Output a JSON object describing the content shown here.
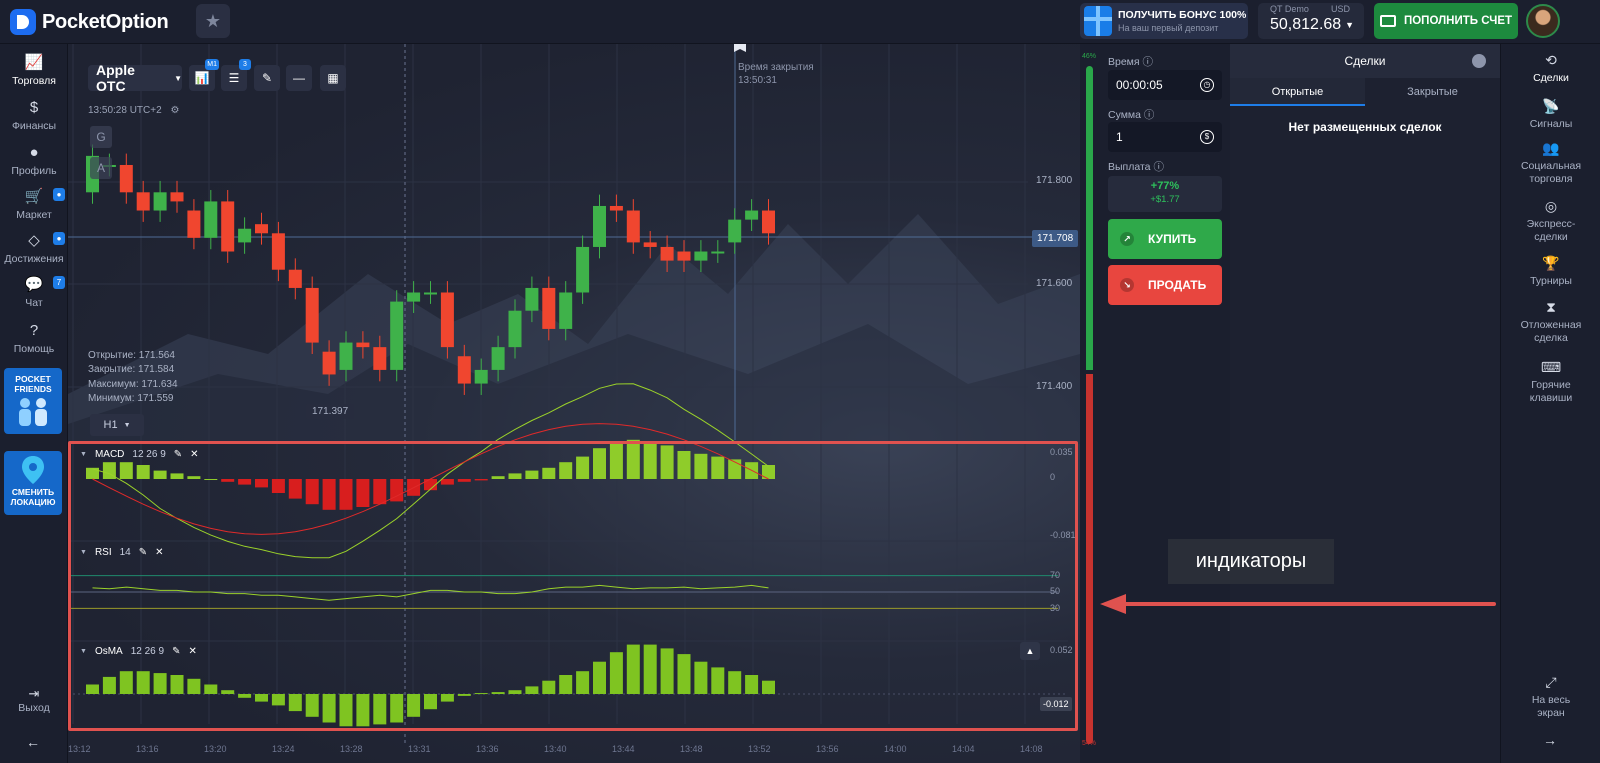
{
  "app": {
    "logo_text": "PocketOption",
    "bonus_title": "ПОЛУЧИТЬ БОНУС 100%",
    "bonus_sub": "На ваш первый депозит",
    "account_label": "QT Demo",
    "account_currency": "USD",
    "balance": "50,812.68",
    "deposit_label": "ПОПОЛНИТЬ СЧЕТ"
  },
  "left_nav": {
    "items": [
      {
        "label": "Торговля",
        "icon": "chart-line-icon",
        "badge": ""
      },
      {
        "label": "Финансы",
        "icon": "dollar-icon",
        "badge": ""
      },
      {
        "label": "Профиль",
        "icon": "user-icon",
        "badge": ""
      },
      {
        "label": "Маркет",
        "icon": "cart-icon",
        "badge": "●"
      },
      {
        "label": "Достижения",
        "icon": "diamond-icon",
        "badge": "●"
      },
      {
        "label": "Чат",
        "icon": "chat-icon",
        "badge": "7"
      },
      {
        "label": "Помощь",
        "icon": "help-icon",
        "badge": ""
      }
    ],
    "promo_friends": "POCKET FRIENDS",
    "promo_location": "СМЕНИТЬ ЛОКАЦИЮ",
    "exit_label": "Выход"
  },
  "chart": {
    "asset": "Apple OTC",
    "indicator_badge_m1": "M1",
    "indicator_badge_count": "3",
    "server_time": "13:50:28 UTC+2",
    "drawing_buttons": [
      "G",
      "A"
    ],
    "ohlc": {
      "open": "Открытие: 171.564",
      "close": "Закрытие: 171.584",
      "high": "Максимум: 171.634",
      "low": "Минимум: 171.559"
    },
    "timeframe": "H1",
    "close_time_label": "Время закрытия",
    "close_time_value": "13:50:31",
    "price_ticks": [
      "171.800",
      "171.600",
      "171.400"
    ],
    "current_price": "171.708",
    "low_marker": "171.397",
    "x_ticks": [
      "13:12",
      "13:16",
      "13:20",
      "13:24",
      "13:28",
      "13:31",
      "13:36",
      "13:40",
      "13:44",
      "13:48",
      "13:52",
      "13:56",
      "14:00",
      "14:04",
      "14:08"
    ],
    "colors": {
      "up": "#3fb24a",
      "down": "#f0462f",
      "macd_line": "#9bd22a",
      "signal_line": "#e02a2a",
      "rsi_line": "#9bd22a"
    }
  },
  "indicators": {
    "macd": {
      "name": "MACD",
      "params": "12 26 9",
      "scale": [
        "0.035",
        "0",
        "-0.081"
      ]
    },
    "rsi": {
      "name": "RSI",
      "params": "14",
      "scale": [
        "70",
        "50",
        "30"
      ]
    },
    "osma": {
      "name": "OsMA",
      "params": "12 26 9",
      "scale": [
        "0.052"
      ],
      "value": "-0.012"
    }
  },
  "volume": {
    "up_pct": "46%",
    "down_pct": "54%"
  },
  "trade": {
    "time_label": "Время",
    "time_value": "00:00:05",
    "amount_label": "Сумма",
    "amount_value": "1",
    "payout_label": "Выплата",
    "payout_pct": "+77%",
    "payout_amount": "+$1.77",
    "buy_label": "КУПИТЬ",
    "sell_label": "ПРОДАТЬ"
  },
  "deals": {
    "title": "Сделки",
    "tab_open": "Открытые",
    "tab_closed": "Закрытые",
    "empty": "Нет размещенных сделок"
  },
  "annotation": {
    "label": "индикаторы"
  },
  "right_nav": {
    "items": [
      {
        "label": "Сделки",
        "icon": "deals-icon"
      },
      {
        "label": "Сигналы",
        "icon": "signal-icon"
      },
      {
        "label": "Социальная торговля",
        "icon": "users-icon"
      },
      {
        "label": "Экспресс-сделки",
        "icon": "target-icon"
      },
      {
        "label": "Турниры",
        "icon": "trophy-icon"
      },
      {
        "label": "Отложенная сделка",
        "icon": "hourglass-icon"
      },
      {
        "label": "Горячие клавиши",
        "icon": "keyboard-icon"
      }
    ],
    "fullscreen": "На весь экран"
  },
  "chart_data": {
    "type": "candlestick",
    "candles": [
      {
        "o": 171.8,
        "c": 171.88
      },
      {
        "o": 171.86,
        "c": 171.86
      },
      {
        "o": 171.86,
        "c": 171.8
      },
      {
        "o": 171.8,
        "c": 171.76
      },
      {
        "o": 171.76,
        "c": 171.8
      },
      {
        "o": 171.8,
        "c": 171.78
      },
      {
        "o": 171.76,
        "c": 171.7
      },
      {
        "o": 171.7,
        "c": 171.78
      },
      {
        "o": 171.78,
        "c": 171.67
      },
      {
        "o": 171.69,
        "c": 171.72
      },
      {
        "o": 171.73,
        "c": 171.71
      },
      {
        "o": 171.71,
        "c": 171.63
      },
      {
        "o": 171.63,
        "c": 171.59
      },
      {
        "o": 171.59,
        "c": 171.47
      },
      {
        "o": 171.45,
        "c": 171.4
      },
      {
        "o": 171.41,
        "c": 171.47
      },
      {
        "o": 171.47,
        "c": 171.46
      },
      {
        "o": 171.46,
        "c": 171.41
      },
      {
        "o": 171.41,
        "c": 171.56
      },
      {
        "o": 171.56,
        "c": 171.58
      },
      {
        "o": 171.58,
        "c": 171.58
      },
      {
        "o": 171.58,
        "c": 171.46
      },
      {
        "o": 171.44,
        "c": 171.38
      },
      {
        "o": 171.38,
        "c": 171.41
      },
      {
        "o": 171.41,
        "c": 171.46
      },
      {
        "o": 171.46,
        "c": 171.54
      },
      {
        "o": 171.54,
        "c": 171.59
      },
      {
        "o": 171.59,
        "c": 171.5
      },
      {
        "o": 171.5,
        "c": 171.58
      },
      {
        "o": 171.58,
        "c": 171.68
      },
      {
        "o": 171.68,
        "c": 171.77
      },
      {
        "o": 171.77,
        "c": 171.76
      },
      {
        "o": 171.76,
        "c": 171.69
      },
      {
        "o": 171.69,
        "c": 171.68
      },
      {
        "o": 171.68,
        "c": 171.65
      },
      {
        "o": 171.67,
        "c": 171.65
      },
      {
        "o": 171.65,
        "c": 171.67
      },
      {
        "o": 171.67,
        "c": 171.67
      },
      {
        "o": 171.69,
        "c": 171.74
      },
      {
        "o": 171.74,
        "c": 171.76
      },
      {
        "o": 171.76,
        "c": 171.71
      }
    ],
    "macd_hist": [
      0.008,
      0.012,
      0.012,
      0.01,
      0.006,
      0.004,
      0.002,
      0.0,
      -0.002,
      -0.004,
      -0.006,
      -0.01,
      -0.014,
      -0.018,
      -0.022,
      -0.022,
      -0.02,
      -0.018,
      -0.016,
      -0.012,
      -0.008,
      -0.004,
      -0.002,
      -0.001,
      0.002,
      0.004,
      0.006,
      0.008,
      0.012,
      0.016,
      0.022,
      0.026,
      0.028,
      0.026,
      0.024,
      0.02,
      0.018,
      0.016,
      0.014,
      0.012,
      0.01
    ],
    "rsi": [
      55,
      54,
      56,
      54,
      52,
      52,
      50,
      50,
      48,
      48,
      46,
      46,
      44,
      42,
      40,
      42,
      44,
      46,
      44,
      48,
      52,
      52,
      50,
      50,
      48,
      48,
      50,
      54,
      56,
      56,
      58,
      56,
      54,
      55,
      55,
      56,
      54,
      55,
      56,
      58,
      55
    ],
    "osma_hist": [
      0.01,
      0.018,
      0.024,
      0.024,
      0.022,
      0.02,
      0.016,
      0.01,
      0.004,
      -0.004,
      -0.008,
      -0.012,
      -0.018,
      -0.024,
      -0.03,
      -0.034,
      -0.034,
      -0.032,
      -0.03,
      -0.024,
      -0.016,
      -0.008,
      -0.002,
      0.001,
      0.002,
      0.004,
      0.008,
      0.014,
      0.02,
      0.024,
      0.034,
      0.044,
      0.052,
      0.052,
      0.048,
      0.042,
      0.034,
      0.028,
      0.024,
      0.02,
      0.014
    ]
  }
}
